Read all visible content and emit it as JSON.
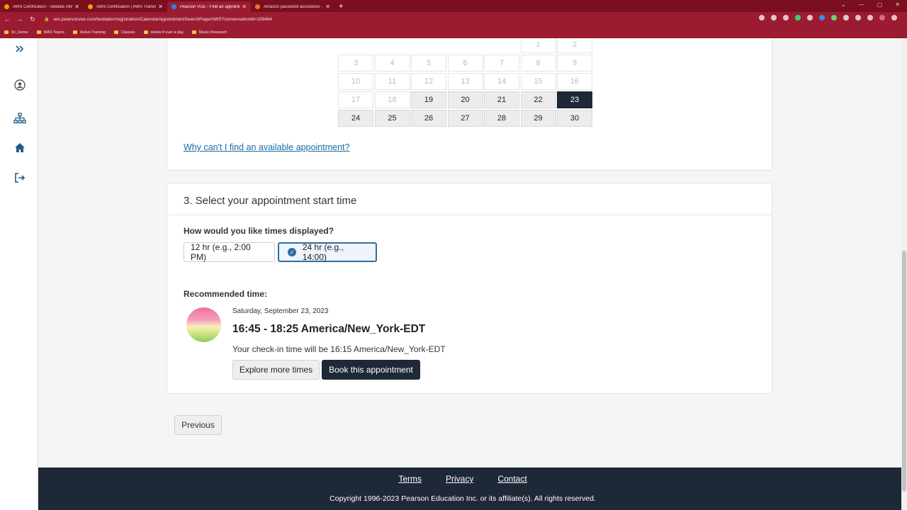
{
  "browser": {
    "tabs": [
      {
        "title": "AWS Certification - Validate AWS",
        "fav_color": "#f39c12",
        "active": false
      },
      {
        "title": "AWS Certification | AWS Training",
        "fav_color": "#f39c12",
        "active": false
      },
      {
        "title": "Pearson VUE - Find an appointm",
        "fav_color": "#2e86de",
        "active": true
      },
      {
        "title": "Amazon password assistance - A",
        "fav_color": "#e67e22",
        "active": false
      }
    ],
    "new_tab": "+",
    "url": "wsr.pearsonvue.com/testtaker/registration/CalendarAppointmentSearchPage/AWS?conversationId=109484",
    "bookmarks": [
      "0z_Home",
      "WAS Topics",
      "Active Training",
      "Classes",
      "delete if over a day",
      "Music Research"
    ]
  },
  "sidebar": {
    "icons": [
      "expand-icon",
      "user-icon",
      "sitemap-icon",
      "home-icon",
      "logout-icon"
    ]
  },
  "calendar": {
    "rows": [
      [
        {
          "d": "",
          "s": "empty"
        },
        {
          "d": "",
          "s": "empty"
        },
        {
          "d": "",
          "s": "empty"
        },
        {
          "d": "",
          "s": "empty"
        },
        {
          "d": "",
          "s": "empty"
        },
        {
          "d": "1",
          "s": "off"
        },
        {
          "d": "2",
          "s": "off"
        }
      ],
      [
        {
          "d": "3",
          "s": "off"
        },
        {
          "d": "4",
          "s": "off"
        },
        {
          "d": "5",
          "s": "off"
        },
        {
          "d": "6",
          "s": "off"
        },
        {
          "d": "7",
          "s": "off"
        },
        {
          "d": "8",
          "s": "off"
        },
        {
          "d": "9",
          "s": "off"
        }
      ],
      [
        {
          "d": "10",
          "s": "off"
        },
        {
          "d": "11",
          "s": "off"
        },
        {
          "d": "12",
          "s": "off"
        },
        {
          "d": "13",
          "s": "off"
        },
        {
          "d": "14",
          "s": "off"
        },
        {
          "d": "15",
          "s": "off"
        },
        {
          "d": "16",
          "s": "off"
        }
      ],
      [
        {
          "d": "17",
          "s": "off"
        },
        {
          "d": "18",
          "s": "off"
        },
        {
          "d": "19",
          "s": "avail"
        },
        {
          "d": "20",
          "s": "avail"
        },
        {
          "d": "21",
          "s": "avail"
        },
        {
          "d": "22",
          "s": "avail"
        },
        {
          "d": "23",
          "s": "selected"
        }
      ],
      [
        {
          "d": "24",
          "s": "avail"
        },
        {
          "d": "25",
          "s": "avail"
        },
        {
          "d": "26",
          "s": "avail"
        },
        {
          "d": "27",
          "s": "avail"
        },
        {
          "d": "28",
          "s": "avail"
        },
        {
          "d": "29",
          "s": "avail"
        },
        {
          "d": "30",
          "s": "avail"
        }
      ]
    ],
    "why_link": "Why can't I find an available appointment?"
  },
  "time_section": {
    "title": "3. Select your appointment start time",
    "question": "How would you like times displayed?",
    "format_12": "12 hr (e.g., 2:00 PM)",
    "format_24": "24 hr (e.g., 14:00)",
    "selected_format": "24",
    "recommended_label": "Recommended time:",
    "recommended_date": "Saturday, September 23, 2023",
    "recommended_time": "16:45 - 18:25 America/New_York-EDT",
    "checkin": "Your check-in time will be 16:15 America/New_York-EDT",
    "explore_button": "Explore more times",
    "book_button": "Book this appointment"
  },
  "previous_button": "Previous",
  "footer": {
    "links": [
      "Terms",
      "Privacy",
      "Contact"
    ],
    "copyright": "Copyright 1996-2023 Pearson Education Inc. or its affiliate(s). All rights reserved."
  },
  "colors": {
    "browser_chrome": "#9b1c31",
    "primary_dark": "#1e2837",
    "link": "#1a6ba5",
    "selected_border": "#2b6ea3"
  }
}
